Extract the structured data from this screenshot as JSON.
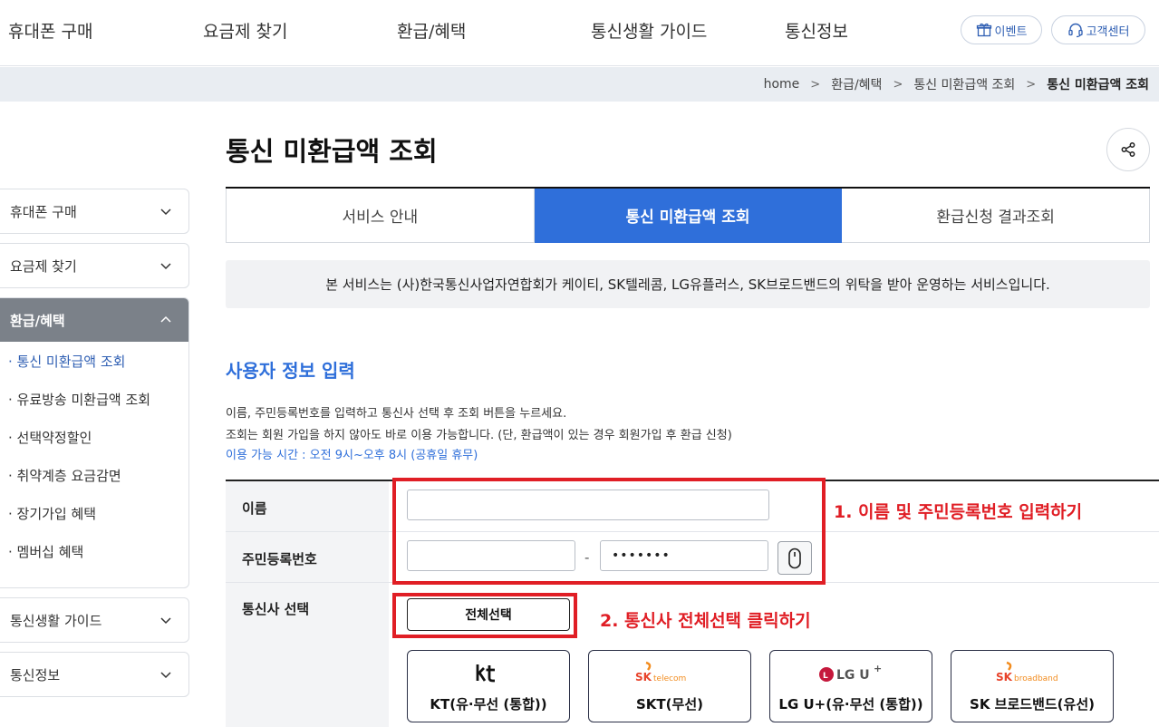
{
  "topnav": {
    "menus": [
      "휴대폰 구매",
      "요금제 찾기",
      "환급/혜택",
      "통신생활 가이드",
      "통신정보"
    ],
    "event_label": "이벤트",
    "support_label": "고객센터"
  },
  "breadcrumb": {
    "items": [
      "home",
      "환급/혜택",
      "통신 미환급액 조회"
    ],
    "current": "통신 미환급액 조회"
  },
  "sidebar": {
    "groups": [
      {
        "label": "휴대폰 구매"
      },
      {
        "label": "요금제 찾기"
      },
      {
        "label": "환급/혜택",
        "open": true,
        "items": [
          "· 통신 미환급액 조회",
          "· 유료방송 미환급액 조회",
          "· 선택약정할인",
          "· 취약계층 요금감면",
          "· 장기가입 혜택",
          "· 멤버십 혜택"
        ],
        "active_index": 0
      },
      {
        "label": "통신생활 가이드"
      },
      {
        "label": "통신정보"
      }
    ]
  },
  "page": {
    "title": "통신 미환급액 조회"
  },
  "tabs": [
    "서비스 안내",
    "통신 미환급액 조회",
    "환급신청 결과조회"
  ],
  "notice": "본 서비스는 (사)한국통신사업자연합회가 케이티, SK텔레콤, LG유플러스, SK브로드밴드의 위탁을 받아 운영하는 서비스입니다.",
  "section": {
    "title": "사용자 정보 입력",
    "desc1": "이름, 주민등록번호를 입력하고 통신사 선택 후 조회 버튼을 누르세요.",
    "desc2": "조회는 회원 가입을 하지 않아도 바로 이용 가능합니다. (단, 환급액이 있는 경우 회원가입 후 환급 신청)",
    "hours": "이용 가능 시간 : 오전 9시~오후 8시 (공휴일 휴무)"
  },
  "form": {
    "name_label": "이름",
    "name_value": "",
    "rrn_label": "주민등록번호",
    "rrn_front_value": "",
    "rrn_back_mask": "•••••••",
    "rrn_dash": "-",
    "carrier_label": "통신사 선택",
    "select_all": "전체선택",
    "carriers": [
      {
        "name": "KT(유·무선 (통합))",
        "logo": "kt"
      },
      {
        "name": "SKT(무선)",
        "logo": "SK telecom"
      },
      {
        "name": "LG U+(유·무선 (통합))",
        "logo": "LG U+"
      },
      {
        "name": "SK 브로드밴드(유선)",
        "logo": "SK broadband"
      }
    ]
  },
  "annotations": {
    "note1": "1. 이름 및 주민등록번호 입력하기",
    "note2": "2. 통신사 전체선택 클릭하기"
  },
  "colors": {
    "accent_blue": "#2f6fda",
    "annotation_red": "#e01e25",
    "sidebar_active_bg": "#7b8189",
    "sk_red": "#e8432b",
    "sk_orange": "#f28c1f",
    "lg_red": "#c5183c"
  }
}
